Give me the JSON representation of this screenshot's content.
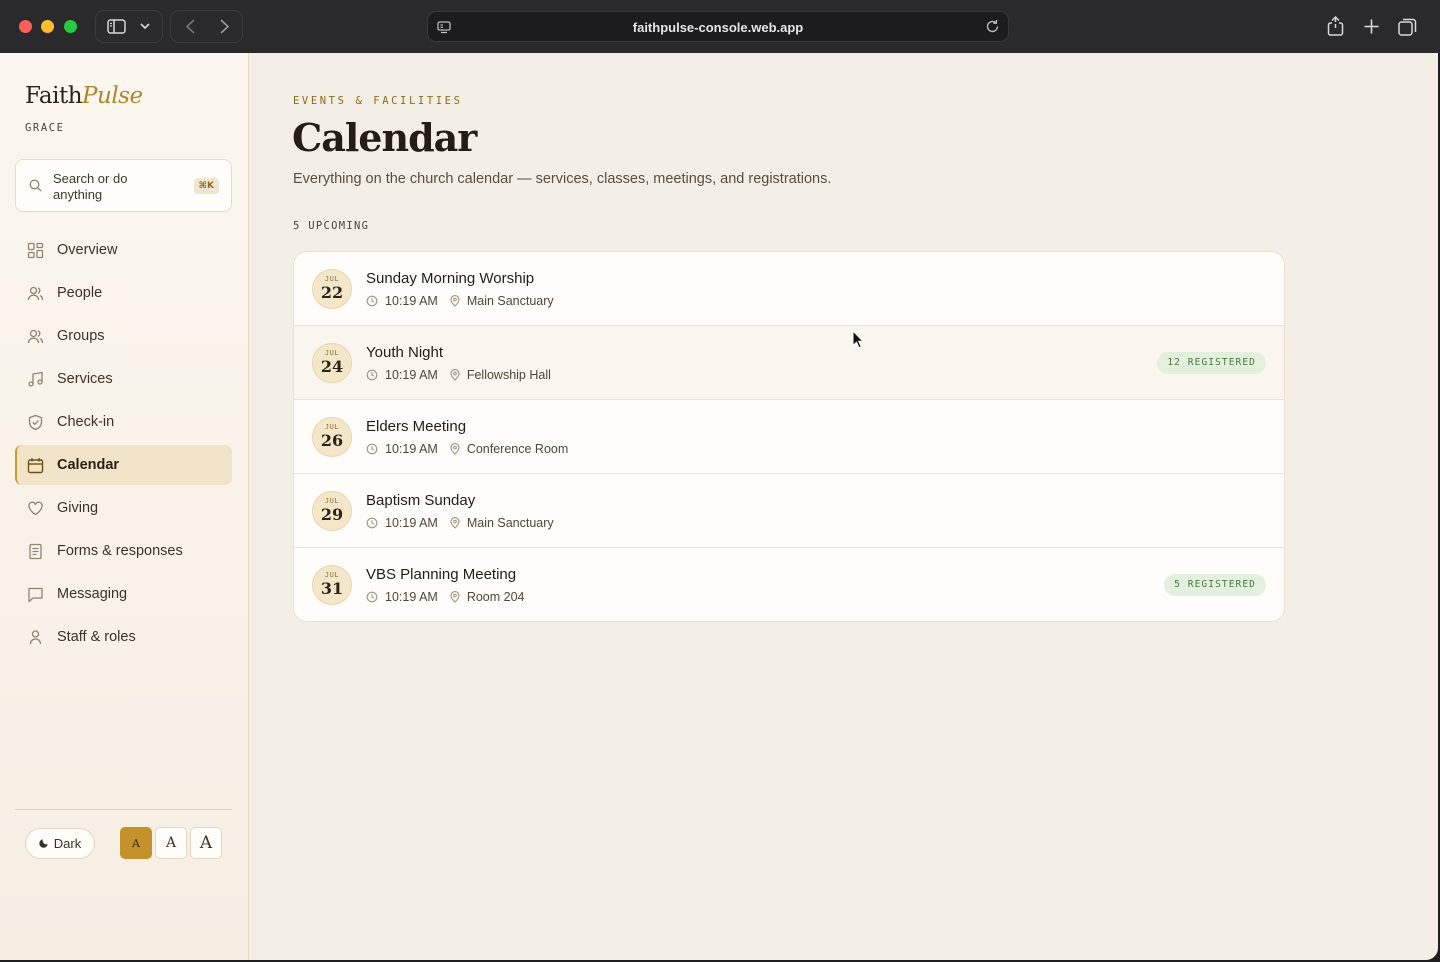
{
  "browser": {
    "url": "faithpulse-console.web.app"
  },
  "sidebar": {
    "brand_main": "Faith",
    "brand_accent": "Pulse",
    "org_name": "GRACE",
    "search": {
      "placeholder": "Search or do anything",
      "shortcut": "⌘K"
    },
    "items": [
      {
        "label": "Overview",
        "icon": "grid-icon"
      },
      {
        "label": "People",
        "icon": "people-icon"
      },
      {
        "label": "Groups",
        "icon": "groups-icon"
      },
      {
        "label": "Services",
        "icon": "music-note-icon"
      },
      {
        "label": "Check-in",
        "icon": "shield-check-icon"
      },
      {
        "label": "Calendar",
        "icon": "calendar-icon",
        "active": true
      },
      {
        "label": "Giving",
        "icon": "heart-icon"
      },
      {
        "label": "Forms & responses",
        "icon": "document-icon"
      },
      {
        "label": "Messaging",
        "icon": "chat-icon"
      },
      {
        "label": "Staff & roles",
        "icon": "user-icon"
      }
    ],
    "theme_toggle": "Dark",
    "font_sizes": [
      "A",
      "A",
      "A"
    ]
  },
  "main": {
    "eyebrow": "EVENTS & FACILITIES",
    "title": "Calendar",
    "subtitle": "Everything on the church calendar — services, classes, meetings, and registrations.",
    "count_label": "5 UPCOMING",
    "events": [
      {
        "month": "JUL",
        "day": "22",
        "title": "Sunday Morning Worship",
        "time": "10:19 AM",
        "location": "Main Sanctuary",
        "badge": ""
      },
      {
        "month": "JUL",
        "day": "24",
        "title": "Youth Night",
        "time": "10:19 AM",
        "location": "Fellowship Hall",
        "badge": "12 REGISTERED"
      },
      {
        "month": "JUL",
        "day": "26",
        "title": "Elders Meeting",
        "time": "10:19 AM",
        "location": "Conference Room",
        "badge": ""
      },
      {
        "month": "JUL",
        "day": "29",
        "title": "Baptism Sunday",
        "time": "10:19 AM",
        "location": "Main Sanctuary",
        "badge": ""
      },
      {
        "month": "JUL",
        "day": "31",
        "title": "VBS Planning Meeting",
        "time": "10:19 AM",
        "location": "Room 204",
        "badge": "5 REGISTERED"
      }
    ]
  },
  "colors": {
    "accent": "#c3922c",
    "active_nav_bg": "#f2e4c9",
    "badge_bg": "#e4f0de",
    "badge_text": "#477a3b"
  }
}
